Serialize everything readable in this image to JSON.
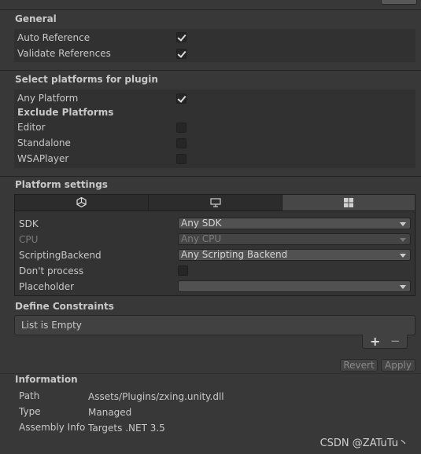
{
  "general": {
    "header": "General",
    "auto_reference": {
      "label": "Auto Reference",
      "checked": true
    },
    "validate_references": {
      "label": "Validate References",
      "checked": true
    }
  },
  "platforms": {
    "header": "Select platforms for plugin",
    "any_platform": {
      "label": "Any Platform",
      "checked": true
    },
    "exclude_header": "Exclude Platforms",
    "excludes": [
      {
        "label": "Editor",
        "checked": false
      },
      {
        "label": "Standalone",
        "checked": false
      },
      {
        "label": "WSAPlayer",
        "checked": false
      }
    ]
  },
  "platform_settings": {
    "header": "Platform settings",
    "tabs": [
      {
        "icon": "unity-icon",
        "active": false
      },
      {
        "icon": "monitor-icon",
        "active": false
      },
      {
        "icon": "windows-icon",
        "active": true
      }
    ],
    "sdk": {
      "label": "SDK",
      "value": "Any SDK"
    },
    "cpu": {
      "label": "CPU",
      "value": "Any CPU"
    },
    "scripting_backend": {
      "label": "ScriptingBackend",
      "value": "Any Scripting Backend"
    },
    "dont_process": {
      "label": "Don't process",
      "checked": false
    },
    "placeholder": {
      "label": "Placeholder",
      "value": ""
    }
  },
  "define_constraints": {
    "header": "Define Constraints",
    "empty_text": "List is Empty",
    "add_label": "+",
    "remove_label": "−"
  },
  "actions": {
    "revert_label": "Revert",
    "apply_label": "Apply"
  },
  "information": {
    "header": "Information",
    "path_key": "Path",
    "path_value": "Assets/Plugins/zxing.unity.dll",
    "type_key": "Type",
    "type_value": "Managed",
    "assembly_key": "Assembly Info",
    "assembly_value": "Targets .NET 3.5"
  },
  "watermark": "CSDN @ZATuTu丶"
}
